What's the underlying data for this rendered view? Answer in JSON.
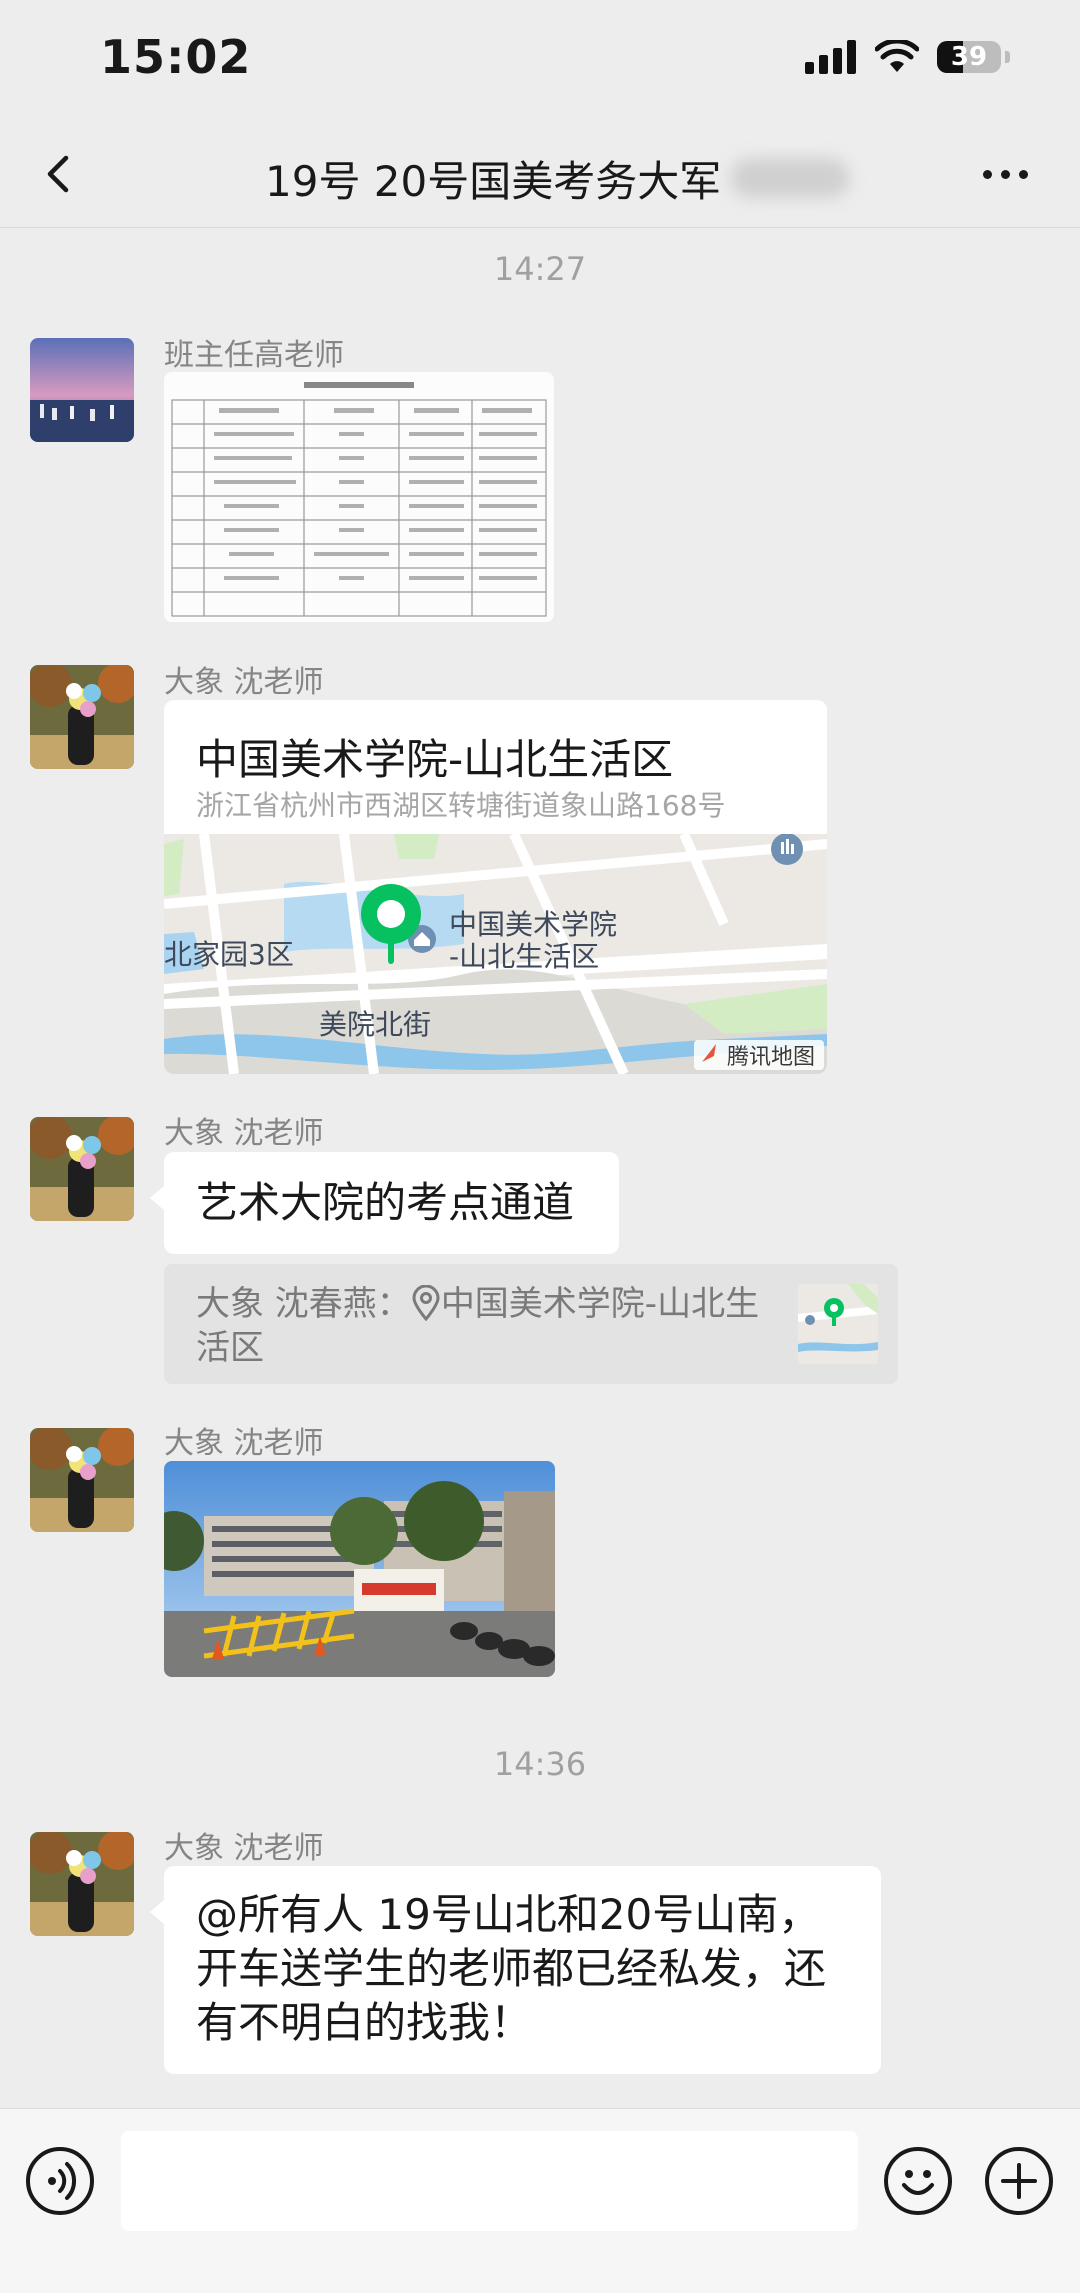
{
  "status_bar": {
    "time": "15:02",
    "battery": "39"
  },
  "nav": {
    "title": "19号 20号国美考务大军"
  },
  "timestamps": [
    "14:27",
    "14:36"
  ],
  "messages": [
    {
      "sender": "班主任高老师",
      "type": "image",
      "image": "document-table-thumbnail"
    },
    {
      "sender": "大象 沈老师",
      "type": "location",
      "title": "中国美术学院-山北生活区",
      "address": "浙江省杭州市西湖区转塘街道象山路168号",
      "map_labels": [
        "中国美术学院",
        "-山北生活区",
        "北家园3区",
        "美院北街"
      ],
      "map_brand": "腾讯地图"
    },
    {
      "sender": "大象 沈老师",
      "type": "text",
      "text": "艺术大院的考点通道",
      "quote": {
        "line1": "大象 沈春燕：",
        "line1_place": "中国美术学院-山北生",
        "line2": "活区"
      }
    },
    {
      "sender": "大象 沈老师",
      "type": "image",
      "image": "campus-entrance-photo"
    },
    {
      "sender": "大象 沈老师",
      "type": "text",
      "lines": [
        "@所有人 19号山北和20号山南，",
        "开车送学生的老师都已经私发，还",
        "有不明白的找我！"
      ]
    }
  ],
  "input": {
    "value": ""
  },
  "colors": {
    "background": "#ededed",
    "bubble": "#ffffff",
    "map_pin": "#07c160"
  }
}
